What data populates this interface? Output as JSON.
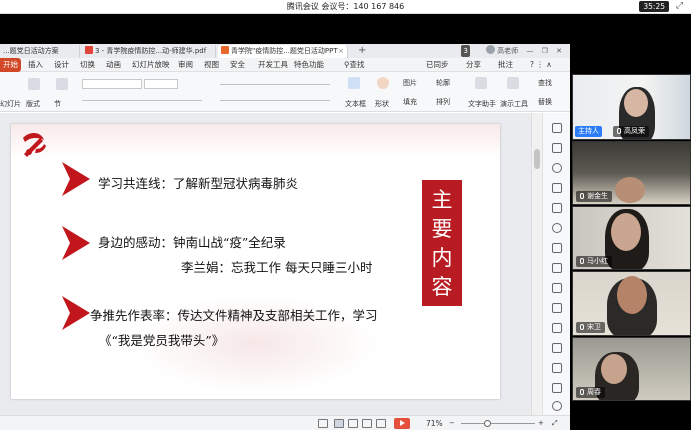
{
  "meeting": {
    "title": "腾讯会议 会议号：140 167 846",
    "timer": "35:25",
    "expand_icon": "expand-icon"
  },
  "wps": {
    "doc_tabs": [
      {
        "label": "...题党日活动方案",
        "icon": "presentation-icon"
      },
      {
        "label": "3 - 青学院疫情防控...动-师建华.pdf",
        "icon": "pdf-icon"
      },
      {
        "label": "青学院\"疫情防控...题党日活动PPT",
        "icon": "presentation-icon"
      }
    ],
    "tab_badge": "3",
    "user_name": "高老师",
    "menu": [
      "开始",
      "插入",
      "设计",
      "切换",
      "动画",
      "幻灯片放映",
      "审阅",
      "视图",
      "安全",
      "开发工具",
      "特色功能",
      "查找"
    ],
    "menu_right": [
      "已同步",
      "分享",
      "批注"
    ],
    "ribbon": {
      "left": [
        "幻灯片",
        "版式",
        "节"
      ],
      "right": [
        "文本框",
        "形状",
        "图片",
        "填充",
        "轮廓",
        "排列",
        "文字助手",
        "演示工具",
        "查找",
        "替换"
      ]
    },
    "zoom": "71%"
  },
  "slide": {
    "title_chars": [
      "主",
      "要",
      "内",
      "容"
    ],
    "items": [
      "学习共连线：了解新型冠状病毒肺炎",
      "身边的感动：钟南山战“疫”全纪录",
      "李兰娟：忘我工作 每天只睡三小时",
      "争推先作表率：传达文件精神及支部相关工作，学习",
      "《“我是党员我带头”》"
    ],
    "colors": {
      "red": "#b81c22",
      "arrow": "#c0161c"
    }
  },
  "participants": [
    {
      "name": "高凤荣",
      "role": "主持人"
    },
    {
      "name": "谢金生",
      "role": ""
    },
    {
      "name": "马小红",
      "role": ""
    },
    {
      "name": "宋卫",
      "role": ""
    },
    {
      "name": "周春",
      "role": ""
    }
  ]
}
